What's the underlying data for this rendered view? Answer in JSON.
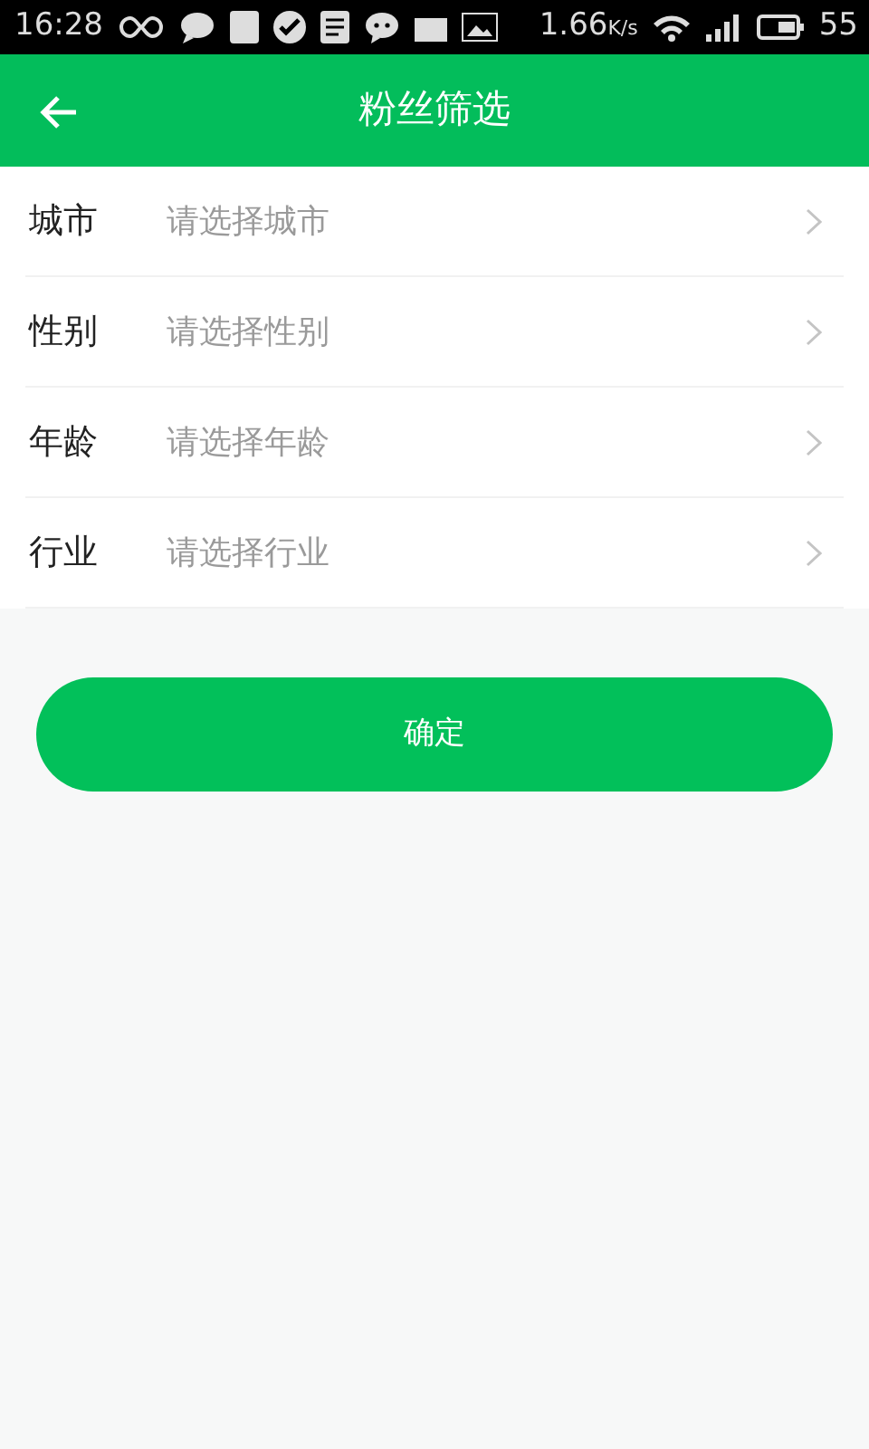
{
  "status_bar": {
    "time": "16:28",
    "speed": "1.66",
    "speed_unit": "K/s",
    "battery": "55"
  },
  "header": {
    "title": "粉丝筛选"
  },
  "fields": [
    {
      "label": "城市",
      "placeholder": "请选择城市"
    },
    {
      "label": "性别",
      "placeholder": "请选择性别"
    },
    {
      "label": "年龄",
      "placeholder": "请选择年龄"
    },
    {
      "label": "行业",
      "placeholder": "请选择行业"
    }
  ],
  "buttons": [
    "确定"
  ]
}
